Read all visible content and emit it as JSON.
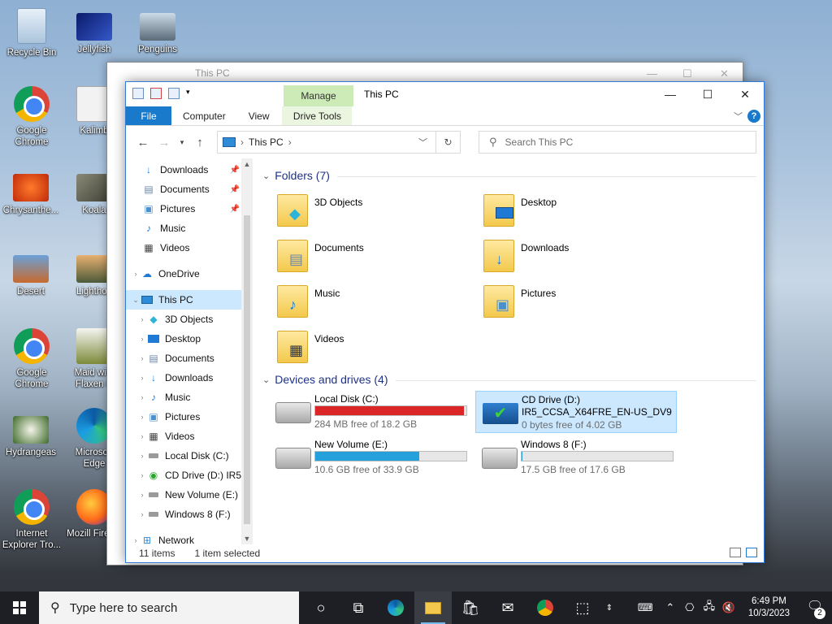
{
  "desktop": {
    "icons": [
      {
        "label": "Recycle Bin",
        "icon": "recycle-bin-icon"
      },
      {
        "label": "Jellyfish",
        "icon": "image-icon"
      },
      {
        "label": "Penguins",
        "icon": "image-icon"
      },
      {
        "label": "Google Chrome",
        "icon": "chrome-icon"
      },
      {
        "label": "Kalimb",
        "icon": "image-icon"
      },
      {
        "label": "Chrysanthe...",
        "icon": "image-icon"
      },
      {
        "label": "Koala",
        "icon": "image-icon"
      },
      {
        "label": "Desert",
        "icon": "image-icon"
      },
      {
        "label": "Lighthou",
        "icon": "image-icon"
      },
      {
        "label": "Google Chrome",
        "icon": "chrome-icon"
      },
      {
        "label": "Maid with Flaxen H",
        "icon": "document-icon"
      },
      {
        "label": "Hydrangeas",
        "icon": "image-icon"
      },
      {
        "label": "Microsoft Edge",
        "icon": "edge-icon"
      },
      {
        "label": "Internet Explorer Tro...",
        "icon": "chrome-icon"
      },
      {
        "label": "Mozill Firefox",
        "icon": "firefox-icon"
      }
    ]
  },
  "back_window": {
    "title": "This PC"
  },
  "window": {
    "title": "This PC",
    "manage_tab": "Manage",
    "ribbon_tabs": [
      "File",
      "Computer",
      "View",
      "Drive Tools"
    ],
    "help": "?",
    "address": {
      "location": "This PC"
    },
    "search_placeholder": "Search This PC"
  },
  "nav": {
    "items": [
      {
        "label": "Downloads",
        "icon": "download-arrow-icon",
        "pinned": true
      },
      {
        "label": "Documents",
        "icon": "documents-icon",
        "pinned": true
      },
      {
        "label": "Pictures",
        "icon": "pictures-icon",
        "pinned": true
      },
      {
        "label": "Music",
        "icon": "music-icon"
      },
      {
        "label": "Videos",
        "icon": "videos-icon"
      },
      {
        "label": "OneDrive",
        "icon": "cloud-icon"
      },
      {
        "label": "This PC",
        "icon": "computer-icon",
        "selected": true
      },
      {
        "label": "3D Objects",
        "icon": "cube-icon"
      },
      {
        "label": "Desktop",
        "icon": "desktop-icon"
      },
      {
        "label": "Documents",
        "icon": "documents-icon"
      },
      {
        "label": "Downloads",
        "icon": "download-arrow-icon"
      },
      {
        "label": "Music",
        "icon": "music-icon"
      },
      {
        "label": "Pictures",
        "icon": "pictures-icon"
      },
      {
        "label": "Videos",
        "icon": "videos-icon"
      },
      {
        "label": "Local Disk (C:)",
        "icon": "drive-icon"
      },
      {
        "label": "CD Drive (D:) IR5",
        "icon": "cd-drive-icon"
      },
      {
        "label": "New Volume (E:)",
        "icon": "drive-icon"
      },
      {
        "label": "Windows 8 (F:)",
        "icon": "drive-icon"
      },
      {
        "label": "Network",
        "icon": "network-icon"
      }
    ]
  },
  "folders": {
    "header": "Folders (7)",
    "items": [
      {
        "label": "3D Objects",
        "icon": "cube-icon"
      },
      {
        "label": "Desktop",
        "icon": "desktop-icon"
      },
      {
        "label": "Documents",
        "icon": "documents-icon"
      },
      {
        "label": "Downloads",
        "icon": "download-arrow-icon"
      },
      {
        "label": "Music",
        "icon": "music-icon"
      },
      {
        "label": "Pictures",
        "icon": "pictures-icon"
      },
      {
        "label": "Videos",
        "icon": "videos-icon"
      }
    ]
  },
  "drives": {
    "header": "Devices and drives (4)",
    "items": [
      {
        "name": "Local Disk (C:)",
        "free": "284 MB free of 18.2 GB",
        "used_fraction": 0.985,
        "bar_color": "#da2626"
      },
      {
        "name": "CD Drive (D:)",
        "subtitle": "IR5_CCSA_X64FRE_EN-US_DV9",
        "free": "0 bytes free of 4.02 GB",
        "selected": true
      },
      {
        "name": "New Volume (E:)",
        "free": "10.6 GB free of 33.9 GB",
        "used_fraction": 0.687,
        "bar_color": "#26a0da"
      },
      {
        "name": "Windows 8 (F:)",
        "free": "17.5 GB free of 17.6 GB",
        "used_fraction": 0.006,
        "bar_color": "#26a0da"
      }
    ]
  },
  "status": {
    "count": "11 items",
    "selection": "1 item selected"
  },
  "taskbar": {
    "search_placeholder": "Type here to search",
    "time": "6:49 PM",
    "date": "10/3/2023",
    "notifications": "2"
  }
}
